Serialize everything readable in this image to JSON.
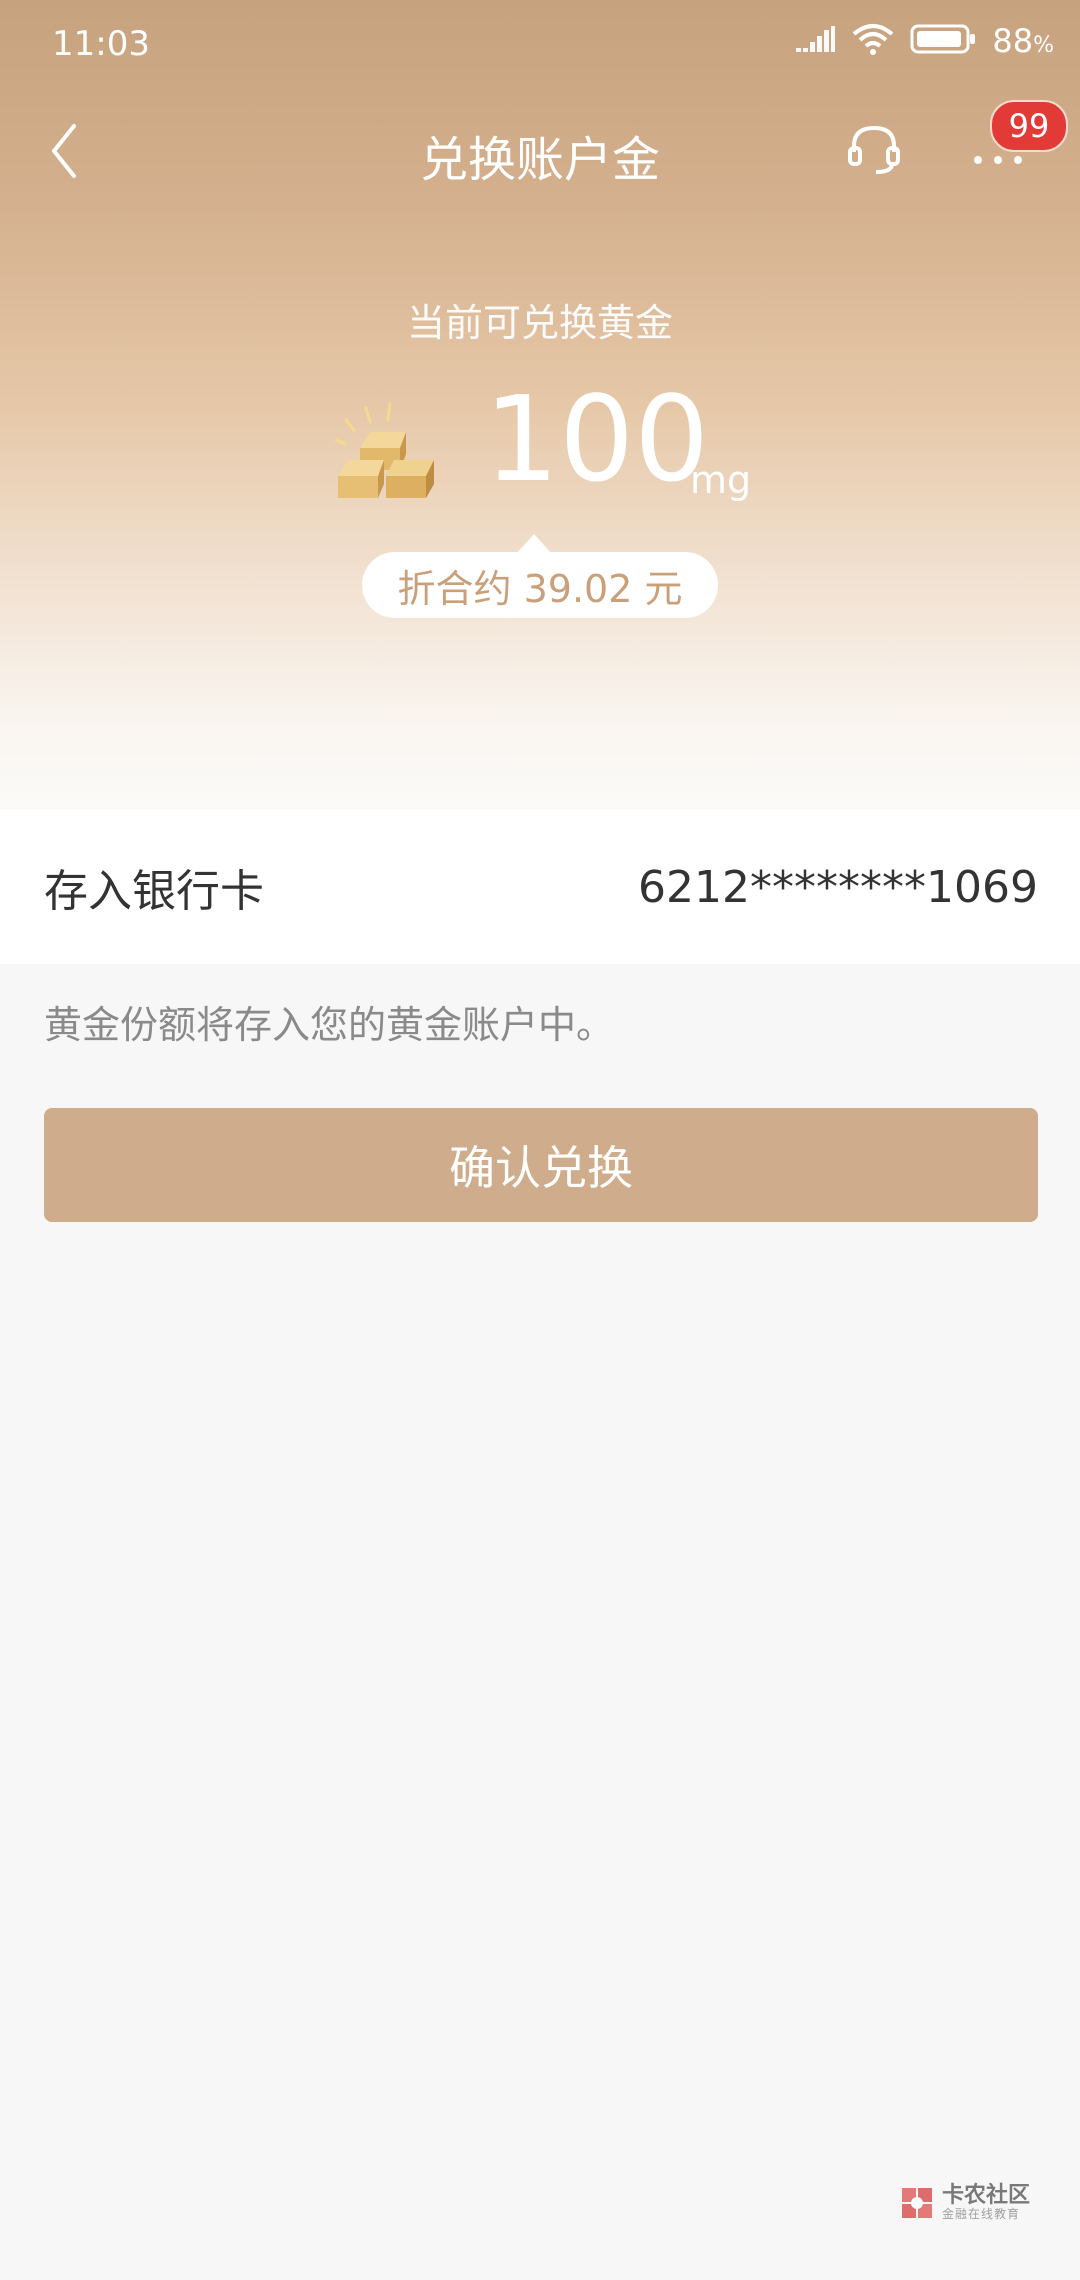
{
  "status_bar": {
    "time": "11:03",
    "battery": "88",
    "battery_unit": "%"
  },
  "nav": {
    "title": "兑换账户金",
    "badge": "99"
  },
  "hero": {
    "label": "当前可兑换黄金",
    "amount": "100",
    "unit": "mg",
    "equivalent": "折合约 39.02 元"
  },
  "bank_card": {
    "label": "存入银行卡",
    "number": "6212********1069"
  },
  "note": "黄金份额将存入您的黄金账户中。",
  "confirm_button": {
    "label": "确认兑换"
  },
  "watermark": {
    "title": "卡农社区",
    "subtitle": "金融在线教育"
  },
  "colors": {
    "accent": "#cfad8c",
    "badge": "#e23a36",
    "hero_top": "#c7a27e"
  },
  "icons": [
    "back-icon",
    "headset-icon",
    "more-icon",
    "gold-bars-icon",
    "signal-icon",
    "wifi-icon",
    "battery-icon"
  ]
}
